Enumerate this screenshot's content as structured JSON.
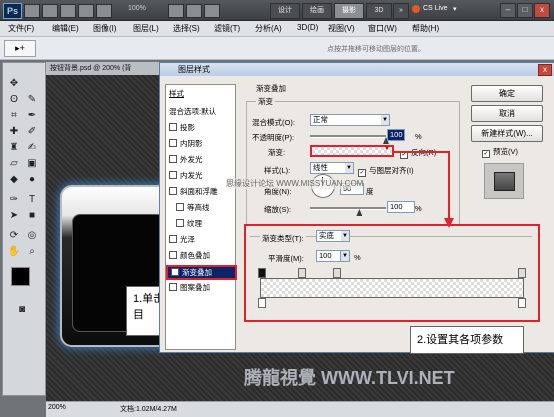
{
  "app": {
    "logo": "Ps",
    "zoom": "100%",
    "workspaces": [
      "设计",
      "绘画",
      "摄影",
      "3D"
    ],
    "active_workspace": "摄影",
    "more": "»",
    "cs_live": "CS Live",
    "cs_live_arrow": "▾",
    "window_buttons": [
      "–",
      "□",
      "x"
    ]
  },
  "menu": [
    "文件(F)",
    "编辑(E)",
    "图像(I)",
    "图层(L)",
    "选择(S)",
    "滤镜(T)",
    "分析(A)",
    "3D(D)",
    "视图(V)",
    "窗口(W)",
    "帮助(H)"
  ],
  "options": {
    "tool_glyph": "▸+",
    "hint": "点按并拖移可移动图层的位置。"
  },
  "document": {
    "tab": "按钮背景.psd @ 200% (背",
    "zoom": "200%",
    "file_info": "文档:1.02M/4.27M"
  },
  "dialog": {
    "title": "图层样式",
    "close": "x",
    "styles_header": "样式",
    "blend_default": "混合选项:默认",
    "style_items": [
      "投影",
      "内阴影",
      "外发光",
      "内发光",
      "斜面和浮雕",
      "等高线",
      "纹理",
      "光泽",
      "颜色叠加",
      "渐变叠加",
      "图案叠加"
    ],
    "selected_style": "渐变叠加",
    "section_title": "渐变叠加",
    "group_title": "渐变",
    "blend_mode_label": "混合模式(O):",
    "blend_mode_value": "正常",
    "opacity_label": "不透明度(P):",
    "opacity_value": "100",
    "opacity_fraction": 1.0,
    "percent": "%",
    "gradient_label": "渐变:",
    "reverse_label": "反向(R)",
    "reverse_checked": true,
    "style_label": "样式(L):",
    "style_value": "线性",
    "align_label": "与图层对齐(I)",
    "align_checked": true,
    "angle_label": "角度(N):",
    "angle_value": "90",
    "angle_unit": "度",
    "scale_label": "缩放(S):",
    "scale_value": "100",
    "scale_fraction": 0.65,
    "watermark_mid": "思缘设计论坛 WWW.MISSYUAN.COM",
    "buttons": {
      "ok": "确定",
      "cancel": "取消",
      "new_style": "新建样式(W)...",
      "preview": "预览(V)"
    },
    "preview_checked": true
  },
  "gradient_editor": {
    "type_label": "渐变类型(T):",
    "type_value": "实底",
    "smooth_label": "平滑度(M):",
    "smooth_value": "100",
    "smooth_unit": "%"
  },
  "callouts": {
    "step1": "1.单击“渐变叠加”项目",
    "step2": "2.设置其各项参数"
  },
  "watermark_bottom": "腾龍視覺 WWW.TLVI.NET",
  "colors": {
    "highlight_red": "#e3212a",
    "selection_blue": "#0a246a",
    "dialog_bg": "#ece9e4",
    "canvas_dark": "#2b2b2b"
  }
}
